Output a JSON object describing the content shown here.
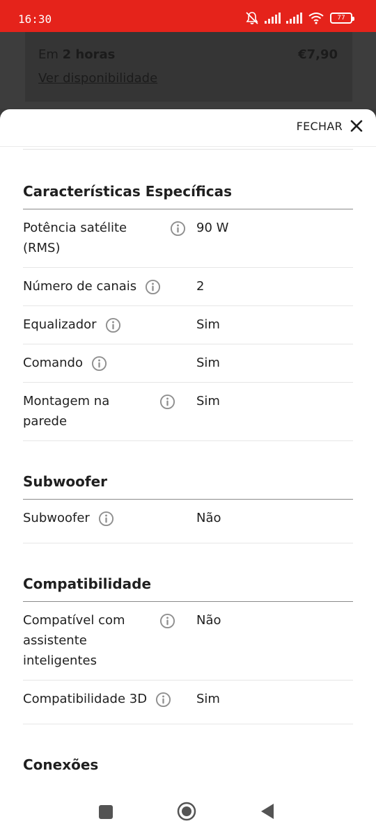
{
  "status": {
    "time": "16:30",
    "battery": "77"
  },
  "backdrop": {
    "delivery_prefix": "Em ",
    "delivery_time": "2 horas",
    "price": "€7,90",
    "link": "Ver disponibilidade"
  },
  "sheet": {
    "close_label": "FECHAR"
  },
  "sections": {
    "specific": {
      "title": "Características Específicas",
      "rows": [
        {
          "label": "Potência satélite (RMS)",
          "value": "90 W"
        },
        {
          "label": "Número de canais",
          "value": "2"
        },
        {
          "label": "Equalizador",
          "value": "Sim"
        },
        {
          "label": "Comando",
          "value": "Sim"
        },
        {
          "label": "Montagem na parede",
          "value": "Sim"
        }
      ]
    },
    "subwoofer": {
      "title": "Subwoofer",
      "rows": [
        {
          "label": "Subwoofer",
          "value": "Não"
        }
      ]
    },
    "compat": {
      "title": "Compatibilidade",
      "rows": [
        {
          "label": "Compatível com assistente inteligentes",
          "value": "Não"
        },
        {
          "label": "Compatibilidade 3D",
          "value": "Sim"
        }
      ]
    },
    "connections": {
      "title": "Conexões"
    }
  },
  "icons": {
    "info": "info-icon",
    "close": "close-icon",
    "mute": "bell-off-icon",
    "wifi": "wifi-icon"
  },
  "colors": {
    "status_bar": "#e5231b",
    "icon_gray": "#8f8f8f"
  }
}
